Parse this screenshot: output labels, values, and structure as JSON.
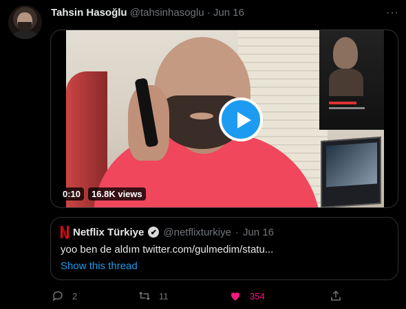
{
  "tweet": {
    "author_name": "Tahsin Hasoğlu",
    "author_handle": "@tahsinhasoglu",
    "separator": "·",
    "date": "Jun 16",
    "more": "···"
  },
  "video": {
    "duration": "0:10",
    "views": "16.8K views"
  },
  "quoted": {
    "author_name": "Netflix Türkiye",
    "verified_mark": "✔",
    "author_handle": "@netflixturkiye",
    "separator": "·",
    "date": "Jun 16",
    "text": "yoo ben de aldım twitter.com/gulmedim/statu...",
    "show_thread": "Show this thread"
  },
  "actions": {
    "reply_count": "2",
    "retweet_count": "11",
    "like_count": "354"
  },
  "colors": {
    "accent": "#1d9bf0",
    "like": "#f91880",
    "netflix": "#e50914",
    "muted": "#71767b"
  }
}
